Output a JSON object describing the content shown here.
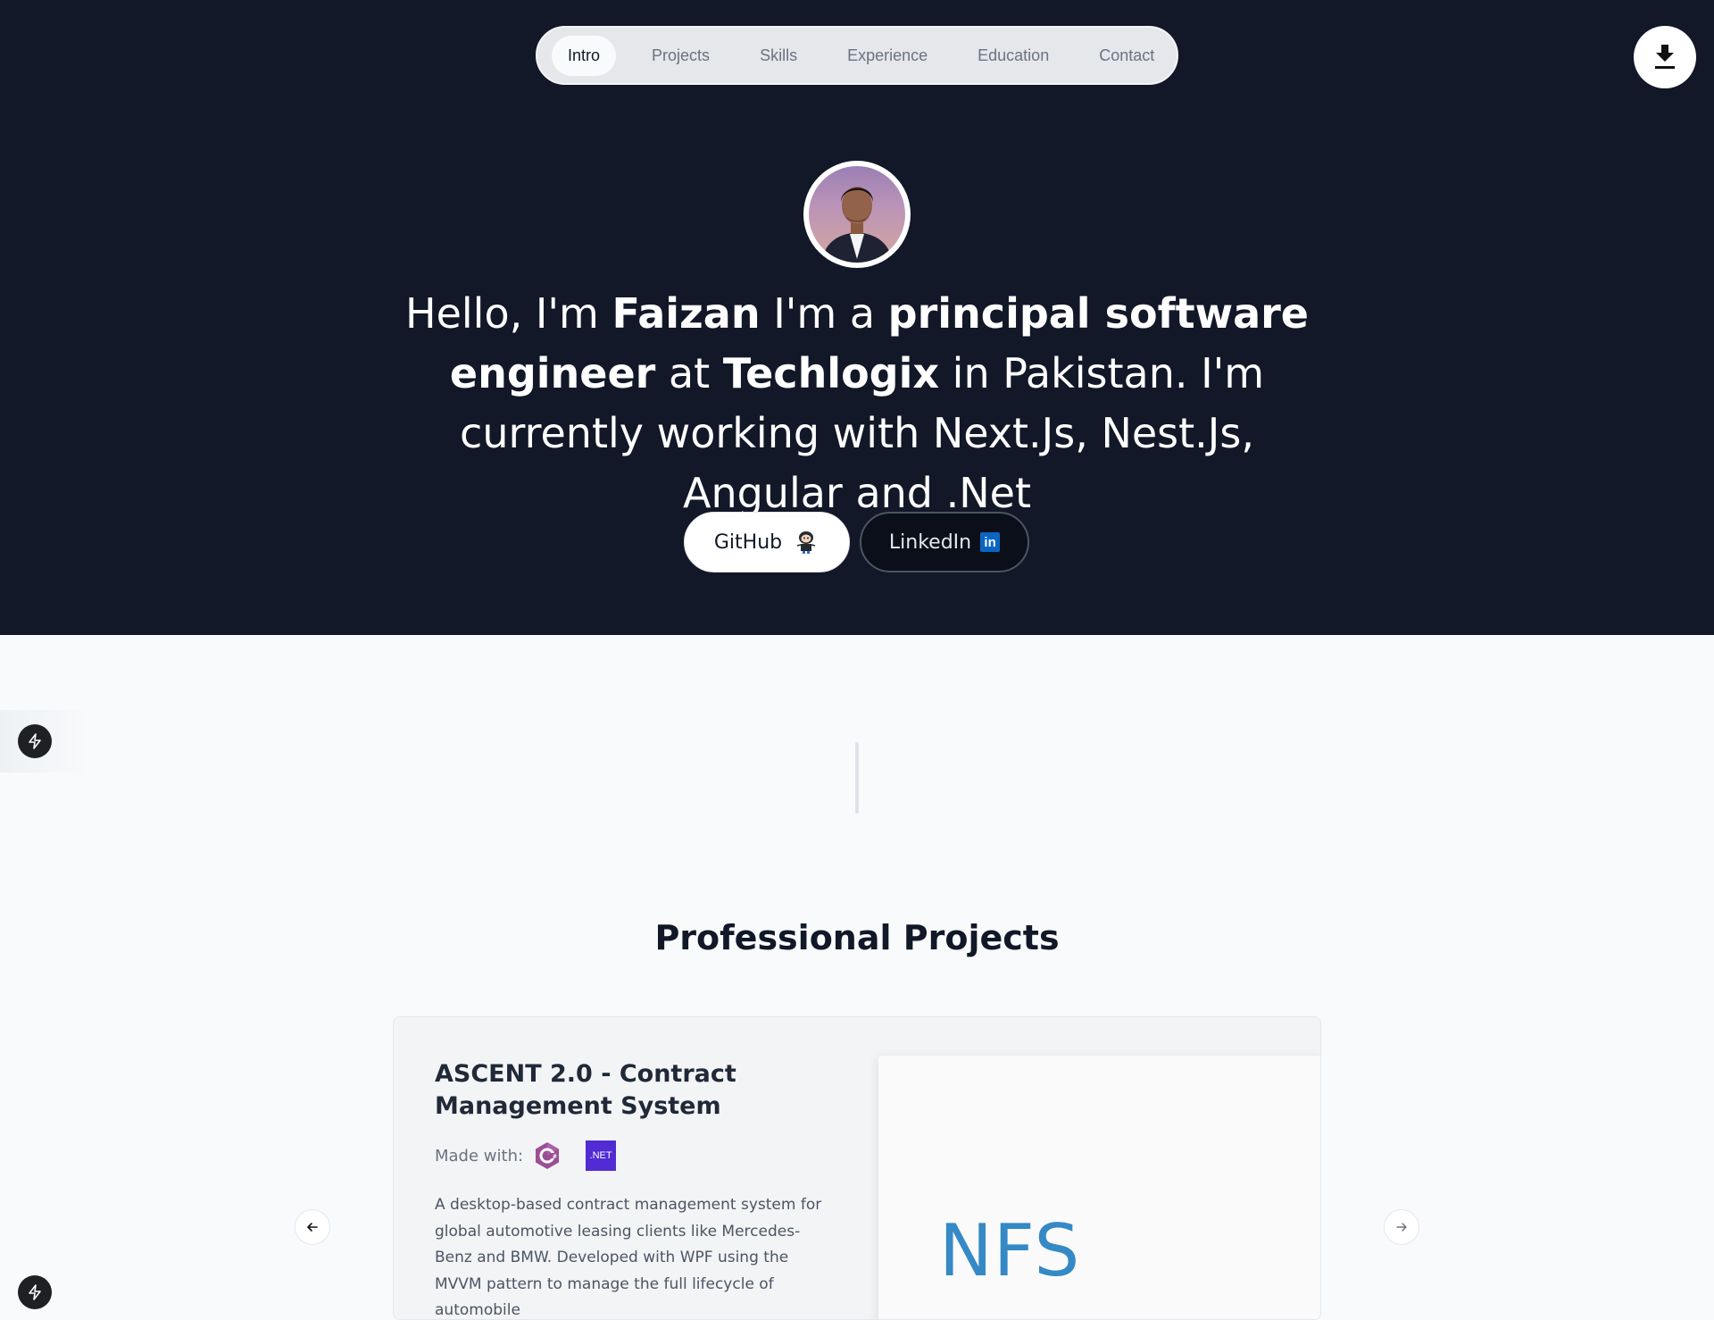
{
  "nav": {
    "items": [
      {
        "label": "Intro",
        "active": true
      },
      {
        "label": "Projects",
        "active": false
      },
      {
        "label": "Skills",
        "active": false
      },
      {
        "label": "Experience",
        "active": false
      },
      {
        "label": "Education",
        "active": false
      },
      {
        "label": "Contact",
        "active": false
      }
    ]
  },
  "header": {
    "download_icon": "download-icon"
  },
  "hero": {
    "intro_part1": "Hello, I'm ",
    "name": "Faizan",
    "intro_part2": " I'm a ",
    "role": "principal software engineer",
    "intro_part3": " at ",
    "company": "Techlogix",
    "intro_part4": " in Pakistan. I'm currently working with Next.Js, Nest.Js, Angular and .Net",
    "github_label": "GitHub",
    "linkedin_label": "LinkedIn",
    "linkedin_badge": "in"
  },
  "projects": {
    "section_title": "Professional Projects",
    "card": {
      "title": "ASCENT 2.0 - Contract Management System",
      "made_with_label": "Made with:",
      "tech_icons": [
        "csharp-icon",
        "dotnet-icon"
      ],
      "net_badge": ".NET",
      "description": "A desktop-based contract management system for global automotive leasing clients like Mercedes-Benz and BMW. Developed with WPF using the MVVM pattern to manage the full lifecycle of automobile",
      "image_logo_text": "NFS"
    }
  },
  "colors": {
    "hero_bg": "#121828",
    "page_bg": "#f8fafc",
    "nfs_blue": "#3589c5",
    "dotnet_purple": "#512bd4",
    "linkedin_blue": "#0a66c2"
  }
}
